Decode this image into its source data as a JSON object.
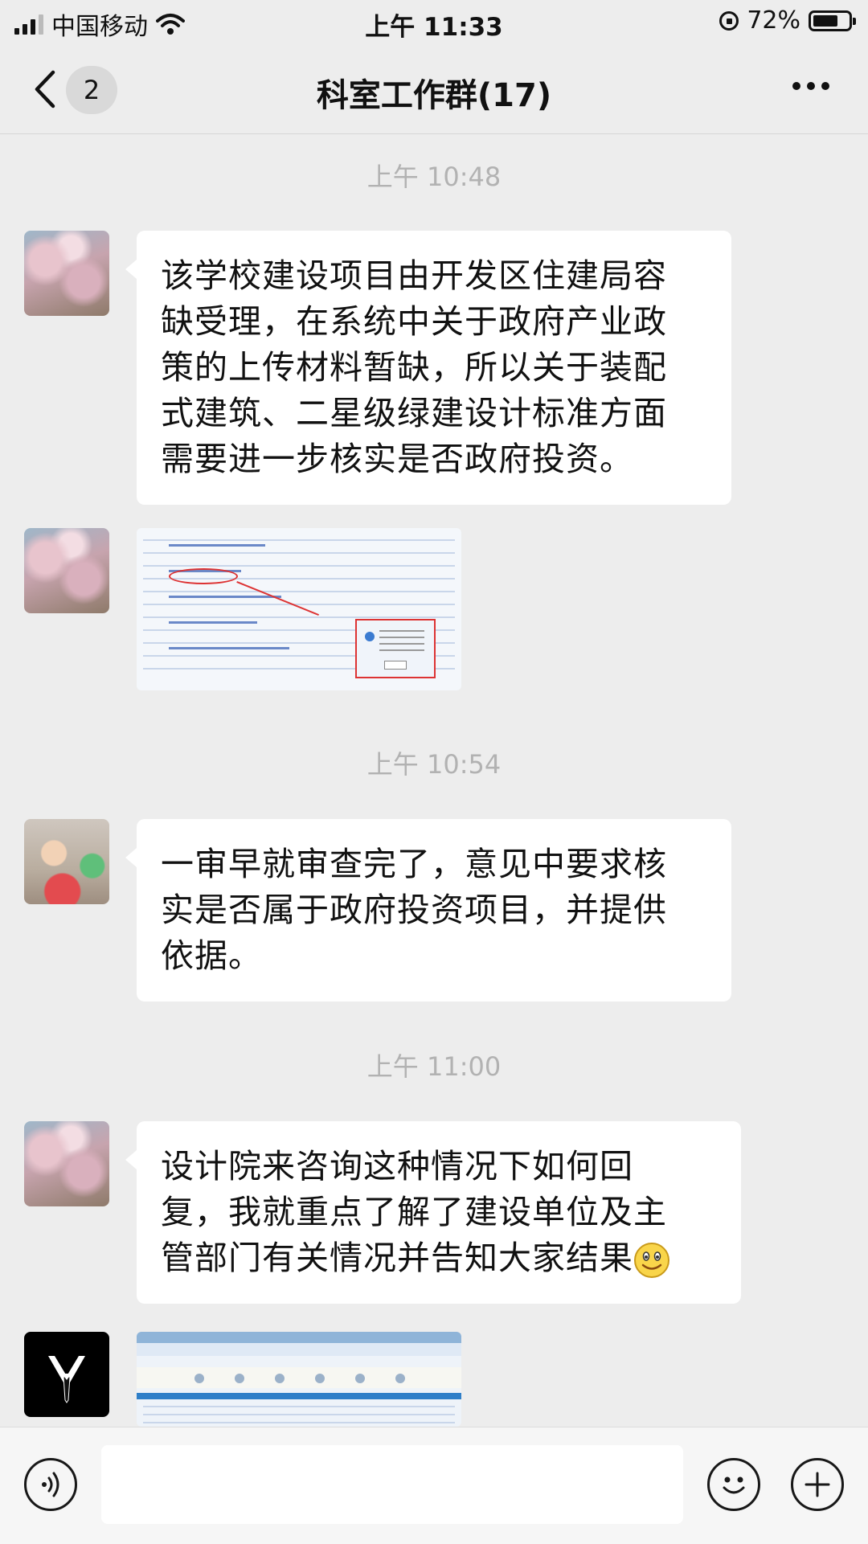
{
  "status_bar": {
    "carrier": "中国移动",
    "time": "上午 11:33",
    "battery": "72%",
    "battery_level": 0.72
  },
  "nav": {
    "back_badge": "2",
    "title": "科室工作群(17)"
  },
  "messages": [
    {
      "time": "上午 10:48"
    },
    {
      "text_lines": [
        "该学校建设项目由开发区住建局容",
        "缺受理，在系统中关于政府产业政",
        "策的上传材料暂缺，所以关于装配",
        "式建筑、二星级绿建设计标准方面",
        "需要进一步核实是否政府投资。"
      ]
    },
    {
      "type": "image",
      "description": "screenshot-thumbnail"
    },
    {
      "time": "上午 10:54"
    },
    {
      "text_lines": [
        "一审早就审查完了，意见中要求核",
        "实是否属于政府投资项目，并提供",
        "依据。"
      ]
    },
    {
      "time": "上午 11:00"
    },
    {
      "text_lines": [
        "设计院来咨询这种情况下如何回",
        "复，我就重点了解了建设单位及主",
        "管部门有关情况并告知大家结果"
      ]
    },
    {
      "type": "image",
      "description": "screenshot-thumbnail-2"
    }
  ],
  "colors": {
    "background": "#ededed",
    "bubble": "#ffffff",
    "time_text": "#b2b2b2"
  },
  "icons": [
    "back-arrow-icon",
    "more-icon",
    "voice-icon",
    "emoji-icon",
    "plus-icon",
    "signal-icon",
    "wifi-icon",
    "battery-icon",
    "smiley-emoji"
  ]
}
